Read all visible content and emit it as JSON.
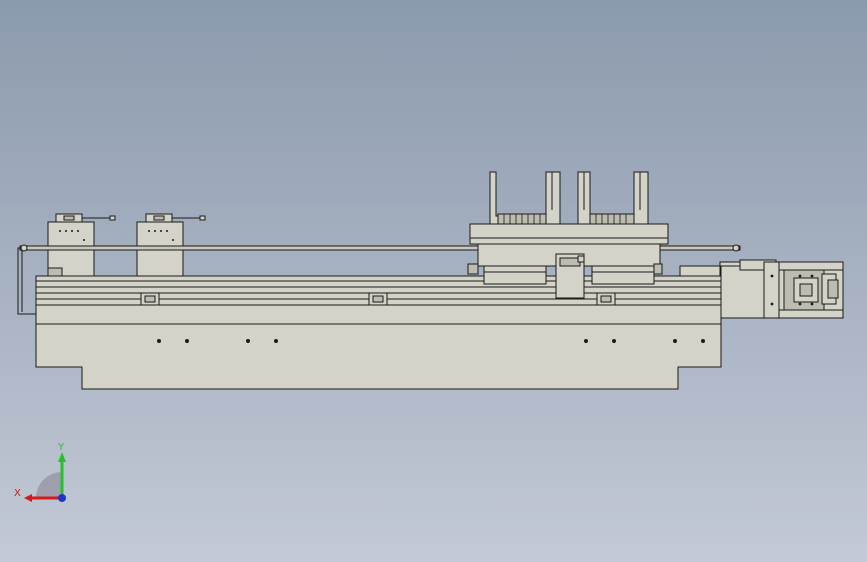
{
  "viewport": {
    "background_top": "#8b9aad",
    "background_bottom": "#c3c9d6",
    "part_fill": "#d4d3c8",
    "part_fill_dark": "#bdbcb1",
    "edge_color": "#1a1a1a"
  },
  "triad": {
    "x_label": "X",
    "y_label": "Y",
    "x_color": "#d41a1a",
    "y_color": "#27c22b",
    "z_color": "#2233cc"
  }
}
